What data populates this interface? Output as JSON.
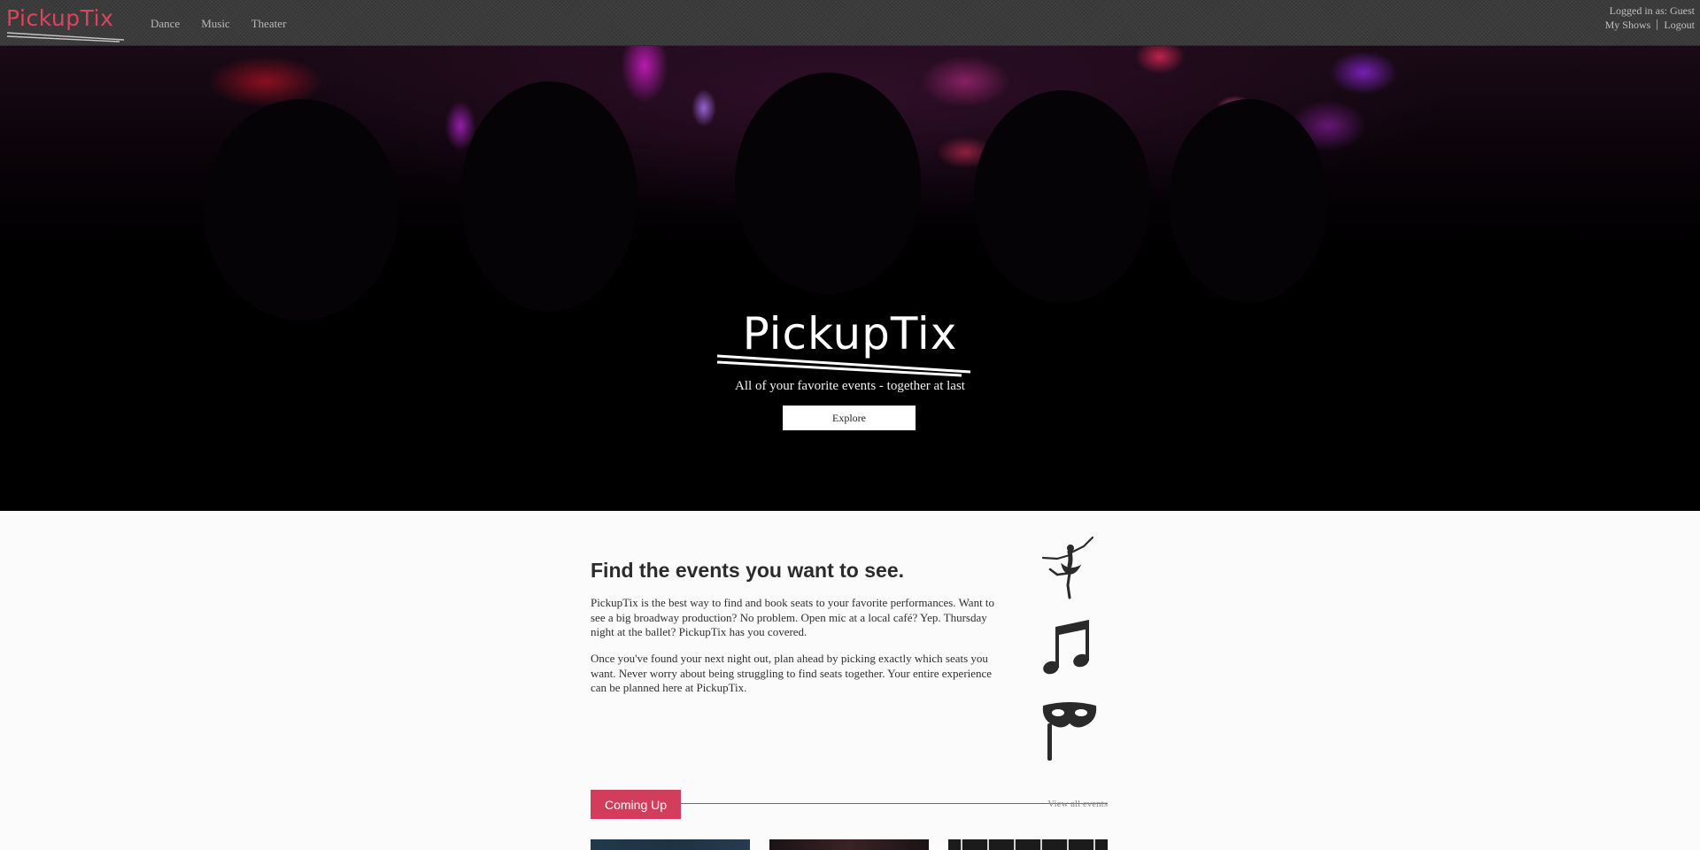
{
  "header": {
    "brand": "PickupTix",
    "nav": [
      {
        "label": "Dance"
      },
      {
        "label": "Music"
      },
      {
        "label": "Theater"
      }
    ],
    "user_status": "Logged in as: Guest",
    "user_links": [
      {
        "label": "My Shows"
      },
      {
        "label": "Logout"
      }
    ]
  },
  "hero": {
    "logo_text": "PickupTix",
    "tagline": "All of your favorite events - together at last",
    "cta_label": "Explore"
  },
  "intro": {
    "title": "Find the events you want to see.",
    "paragraphs": [
      "PickupTix is the best way to find and book seats to your favorite performances. Want to see a big broadway production? No problem. Open mic at a local café? Yep. Thursday night at the ballet? PickupTix has you covered.",
      "Once you've found your next night out, plan ahead by picking exactly which seats you want. Never worry about being struggling to find seats together. Your entire experience can be planned here at PickupTix."
    ],
    "category_icons": [
      "ballet-dancer-icon",
      "music-note-icon",
      "theater-mask-icon"
    ]
  },
  "coming_up": {
    "label": "Coming Up",
    "view_all": "View all events"
  },
  "colors": {
    "accent": "#d13d5a",
    "topbar": "#3b3b3b",
    "hero_bg": "#000000"
  }
}
